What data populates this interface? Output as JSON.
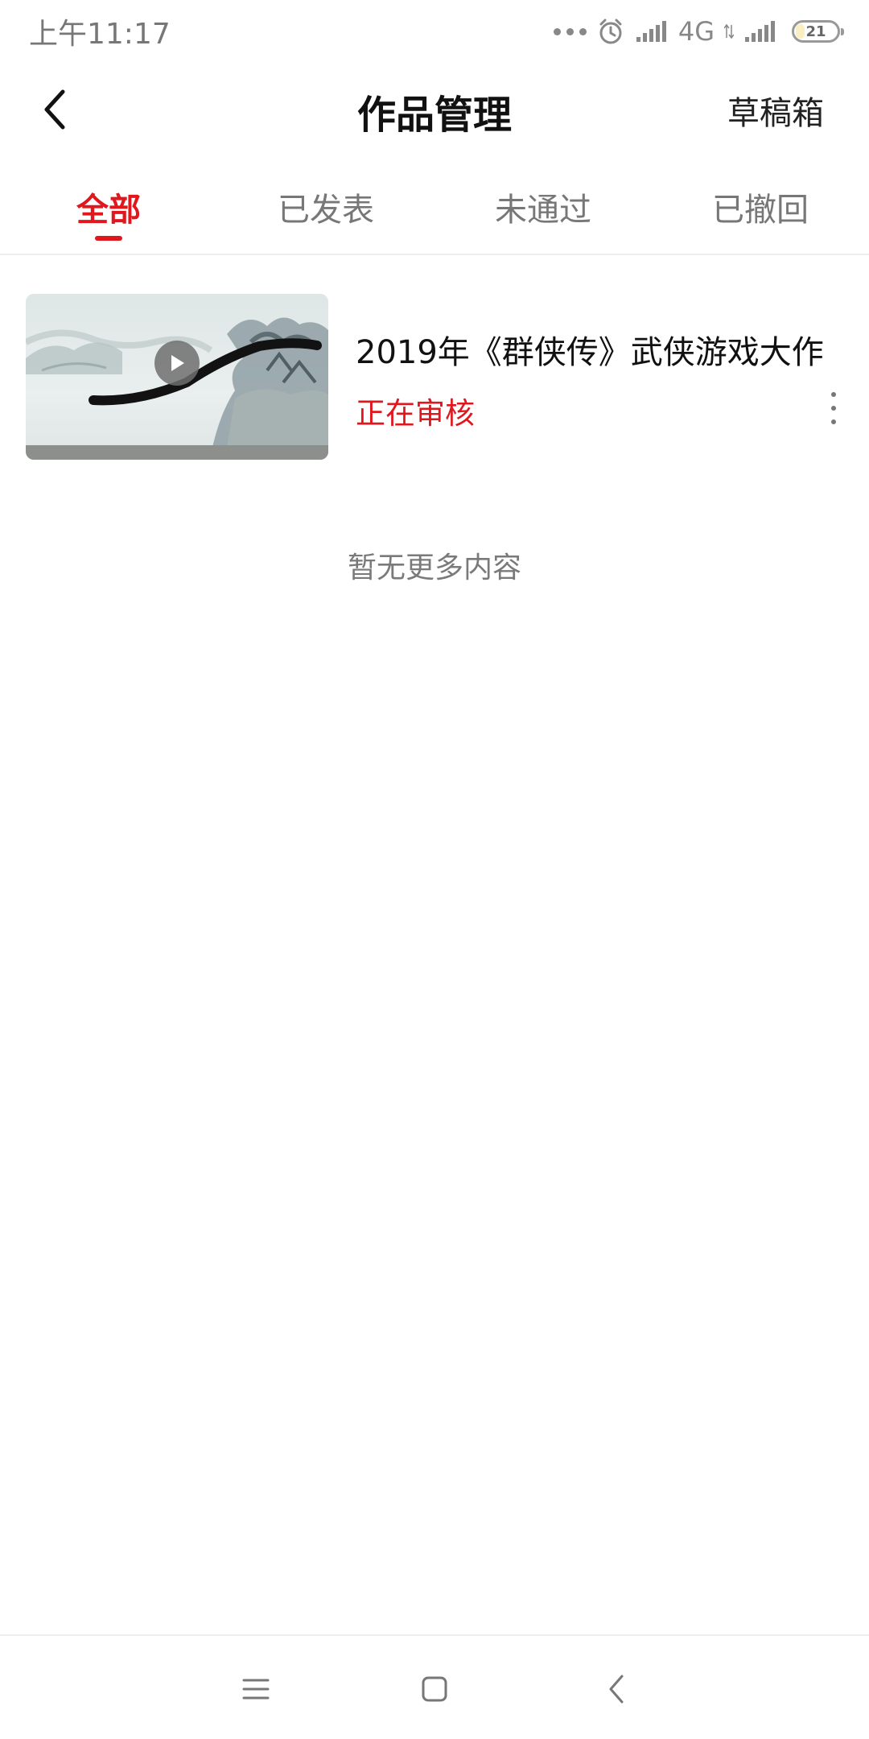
{
  "status_bar": {
    "time": "上午11:17",
    "network": "4G",
    "battery": "21",
    "battery_level_percent": 21
  },
  "header": {
    "title": "作品管理",
    "drafts_label": "草稿箱",
    "back_icon": "chevron-left-icon"
  },
  "tabs": [
    {
      "label": "全部",
      "active": true
    },
    {
      "label": "已发表",
      "active": false
    },
    {
      "label": "未通过",
      "active": false
    },
    {
      "label": "已撤回",
      "active": false
    }
  ],
  "works": [
    {
      "title": "2019年《群侠传》武侠游戏大作",
      "status": "正在审核",
      "thumbnail_icon": "play-icon"
    }
  ],
  "empty_text": "暂无更多内容",
  "colors": {
    "accent": "#e0171d",
    "text_primary": "#111111",
    "text_secondary": "#777777"
  },
  "nav_icons": [
    "menu-icon",
    "home-square-icon",
    "back-icon"
  ]
}
